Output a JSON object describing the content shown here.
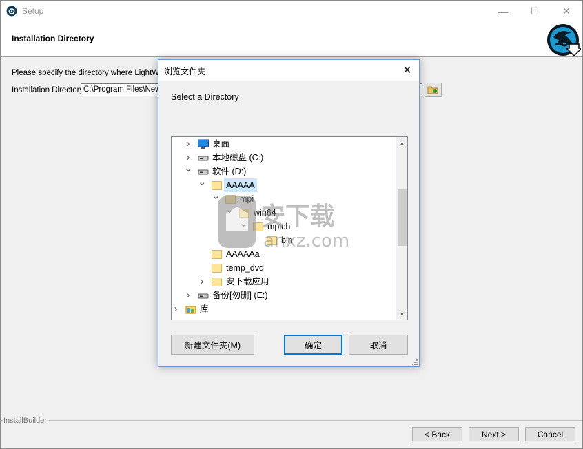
{
  "window": {
    "title": "Setup",
    "minimize_glyph": "—",
    "maximize_glyph": "☐",
    "close_glyph": "✕"
  },
  "header": {
    "title": "Installation Directory"
  },
  "main": {
    "description": "Please specify the directory where LightWave",
    "dir_label": "Installation Directory",
    "dir_value": "C:\\Program Files\\NewTek"
  },
  "footer": {
    "brand": "InstallBuilder",
    "back_label": "< Back",
    "next_label": "Next >",
    "cancel_label": "Cancel"
  },
  "dialog": {
    "title": "浏览文件夹",
    "close_glyph": "✕",
    "prompt": "Select a Directory",
    "tree": [
      {
        "label": "桌面",
        "expander": "collapsed",
        "icon": "desktop-icon",
        "level": 1
      },
      {
        "label": "本地磁盘 (C:)",
        "expander": "collapsed",
        "icon": "drive-icon",
        "level": 1
      },
      {
        "label": "软件 (D:)",
        "expander": "expanded",
        "icon": "drive-icon",
        "level": 1
      },
      {
        "label": "AAAAA",
        "expander": "expanded",
        "icon": "folder-icon",
        "level": 2,
        "selected": true
      },
      {
        "label": "mpi",
        "expander": "expanded",
        "icon": "folder-icon",
        "level": 3
      },
      {
        "label": "win64",
        "expander": "expanded",
        "icon": "folder-icon",
        "level": 4
      },
      {
        "label": "mpich",
        "expander": "expanded",
        "icon": "folder-icon",
        "level": 5
      },
      {
        "label": "bin",
        "expander": "none",
        "icon": "folder-icon",
        "level": 6
      },
      {
        "label": "AAAAAa",
        "expander": "none",
        "icon": "folder-icon",
        "level": 2
      },
      {
        "label": "temp_dvd",
        "expander": "none",
        "icon": "folder-icon",
        "level": 2
      },
      {
        "label": "安下载应用",
        "expander": "collapsed",
        "icon": "folder-icon",
        "level": 2
      },
      {
        "label": "备份[勿删] (E:)",
        "expander": "collapsed",
        "icon": "drive-icon",
        "level": 1
      },
      {
        "label": "库",
        "expander": "collapsed",
        "icon": "library-icon",
        "level": 0
      }
    ],
    "new_folder_label": "新建文件夹(M)",
    "ok_label": "确定",
    "cancel_label": "取消"
  },
  "watermark": {
    "text_cn": "安下载",
    "text_en": "anxz.com"
  }
}
